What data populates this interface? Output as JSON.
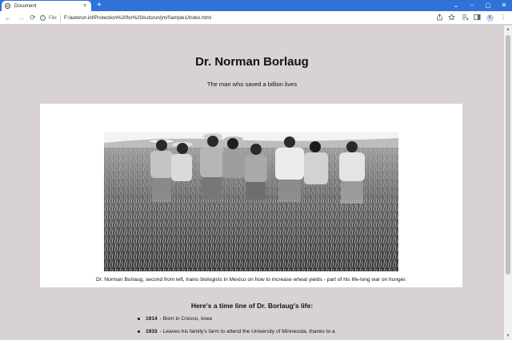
{
  "browser": {
    "tab_title": "Document",
    "tab_close": "×",
    "new_tab": "+",
    "window_controls": [
      "⌄",
      "–",
      "▢",
      "✕"
    ],
    "nav": {
      "back": "←",
      "forward": "→",
      "reload": "⟳"
    },
    "address": {
      "info": "i",
      "scheme": "File",
      "url": "F:/autorun.inf/Protection%20for%20Autorun/jm/Sample1/index.html"
    },
    "toolbar_icons": [
      "share-icon",
      "star-icon",
      "reading-list-icon",
      "sidebar-icon"
    ],
    "profile_initial": "K",
    "menu": "⋮"
  },
  "page": {
    "heading": "Dr. Norman Borlaug",
    "subheading": "The man who saved a billion lives",
    "caption": "Dr. Norman Borlaug, second from left, trains biologists in Mexico on how to increase wheat yields - part of his life-long war on hunger.",
    "timeline_title": "Here's a time line of Dr. Borlaug's life:",
    "timeline": [
      {
        "year": "1914",
        "text": "- Born in Cresco, Iowa"
      },
      {
        "year": "1933",
        "text": "- Leaves his family's farm to attend the University of Minnesota, thanks to a"
      }
    ]
  }
}
